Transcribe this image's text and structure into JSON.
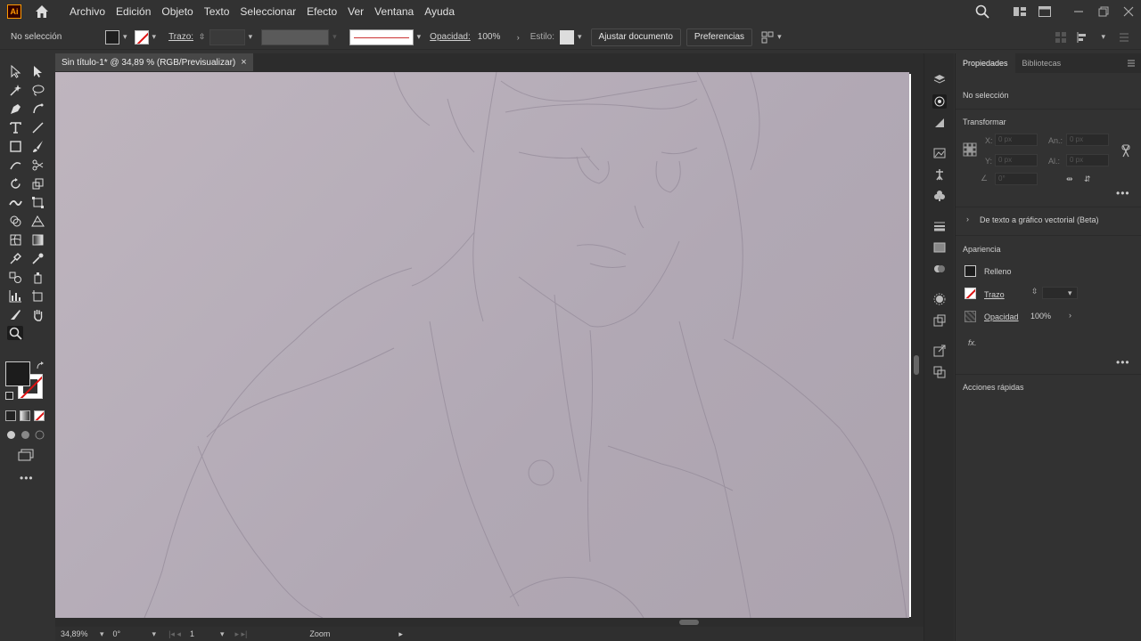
{
  "menubar": {
    "app_icon": "Ai",
    "menus": [
      "Archivo",
      "Edición",
      "Objeto",
      "Texto",
      "Seleccionar",
      "Efecto",
      "Ver",
      "Ventana",
      "Ayuda"
    ]
  },
  "controlbar": {
    "selection": "No selección",
    "stroke_label": "Trazo:",
    "opacity_label": "Opacidad:",
    "opacity_value": "100%",
    "style_label": "Estilo:",
    "fit_button": "Ajustar documento",
    "prefs_button": "Preferencias"
  },
  "document": {
    "tab_title": "Sin título-1* @ 34,89 % (RGB/Previsualizar)",
    "close": "×"
  },
  "statusbar": {
    "zoom": "34,89%",
    "rotation": "0°",
    "artboard": "1",
    "tool": "Zoom"
  },
  "panel": {
    "tabs": [
      "Propiedades",
      "Bibliotecas"
    ],
    "no_selection": "No selección",
    "transform_title": "Transformar",
    "x_label": "X:",
    "y_label": "Y:",
    "w_label": "An.:",
    "h_label": "Al.:",
    "x_value": "0 px",
    "y_value": "0 px",
    "w_value": "0 px",
    "h_value": "0 px",
    "angle_value": "0°",
    "vectorize": "De texto a gráfico vectorial (Beta)",
    "appearance_title": "Apariencia",
    "fill_label": "Relleno",
    "stroke_label": "Trazo",
    "opacity_label": "Opacidad",
    "opacity_value": "100%",
    "fx": "fx.",
    "quick_actions": "Acciones rápidas"
  },
  "colors": {
    "app_bg": "#323232",
    "canvas": "#b8afba",
    "accent_stroke": "#d11111",
    "logo_orange": "#ff9a00"
  }
}
